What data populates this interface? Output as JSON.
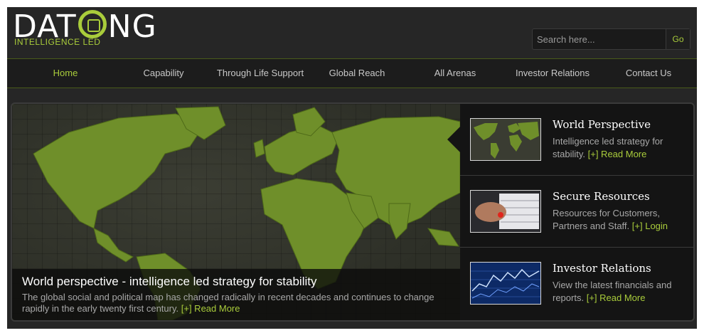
{
  "brand": {
    "logo_text": "DATONG",
    "tagline": "INTELLIGENCE LED",
    "accent_color": "#a9cc3b"
  },
  "search": {
    "placeholder": "Search here...",
    "go_label": "Go"
  },
  "nav": {
    "items": [
      {
        "label": "Home",
        "active": true
      },
      {
        "label": "Capability",
        "active": false
      },
      {
        "label": "Through Life Support",
        "active": false
      },
      {
        "label": "Global Reach",
        "active": false
      },
      {
        "label": "All Arenas",
        "active": false
      },
      {
        "label": "Investor Relations",
        "active": false
      },
      {
        "label": "Contact Us",
        "active": false
      }
    ]
  },
  "hero": {
    "title": "World perspective - intelligence led strategy for stability",
    "text": "The global social and political map has changed radically in recent decades and continues to change rapidly in the early twenty first century.",
    "more_label": "[+] Read More"
  },
  "panels": [
    {
      "title": "World Perspective",
      "text": "Intelligence led strategy for stability.",
      "link_label": "[+] Read More",
      "thumb_icon": "world-map-thumbnail"
    },
    {
      "title": "Secure Resources",
      "text": "Resources for Customers, Partners and Staff.",
      "link_label": "[+] Login",
      "thumb_icon": "keyboard-thumbnail"
    },
    {
      "title": "Investor Relations",
      "text": "View the latest financials and reports.",
      "link_label": "[+] Read More",
      "thumb_icon": "financial-chart-thumbnail"
    }
  ]
}
